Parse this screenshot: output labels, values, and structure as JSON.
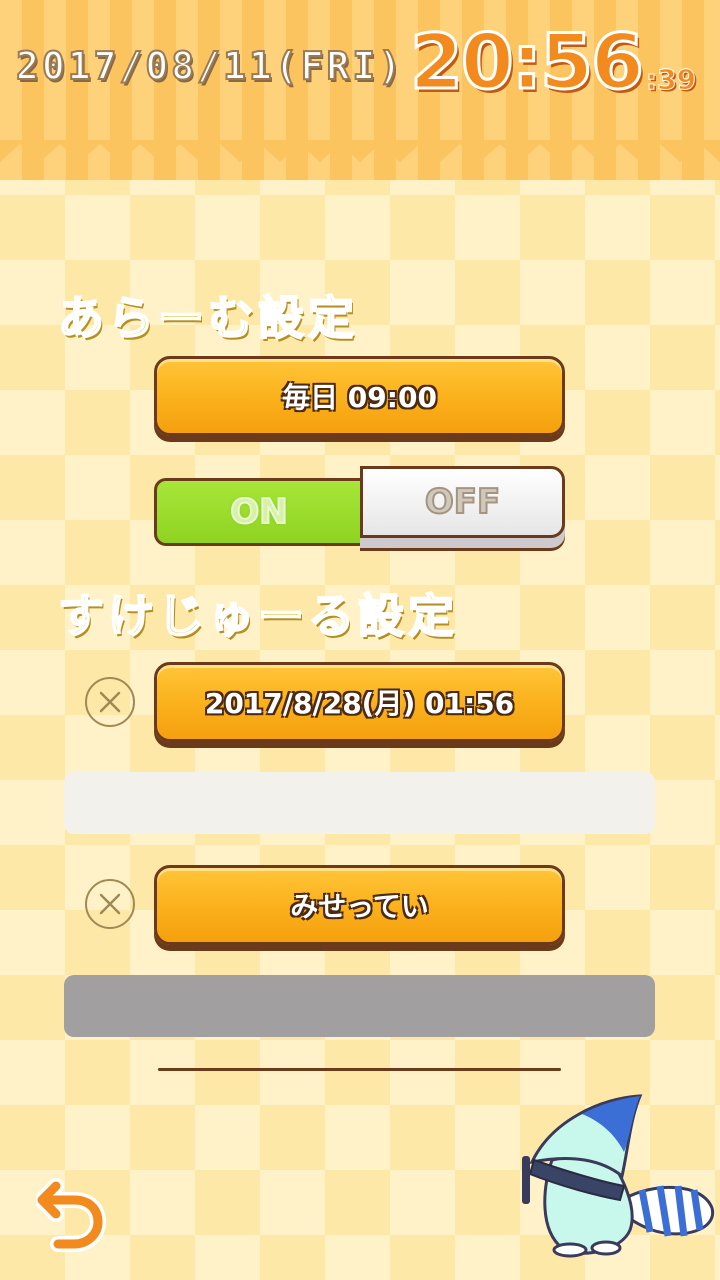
{
  "header": {
    "date": "2017/08/11(FRI)",
    "time": "20:56",
    "seconds": ":39"
  },
  "alarm": {
    "title": "あらーむ設定",
    "time_button": "毎日 09:00",
    "toggle_on": "ON",
    "toggle_off": "OFF",
    "state": "ON"
  },
  "schedule": {
    "title": "すけじゅーる設定",
    "items": [
      {
        "label": "2017/8/28(月) 01:56"
      },
      {
        "label": "みせってい"
      }
    ]
  },
  "icons": {
    "delete": "close-icon",
    "back": "undo-arrow-icon",
    "mascot": "mascot-character"
  },
  "colors": {
    "accent": "#f28a1e",
    "button": "#fbb21c",
    "toggle_on": "#8fd321",
    "title": "#e5bd33"
  }
}
